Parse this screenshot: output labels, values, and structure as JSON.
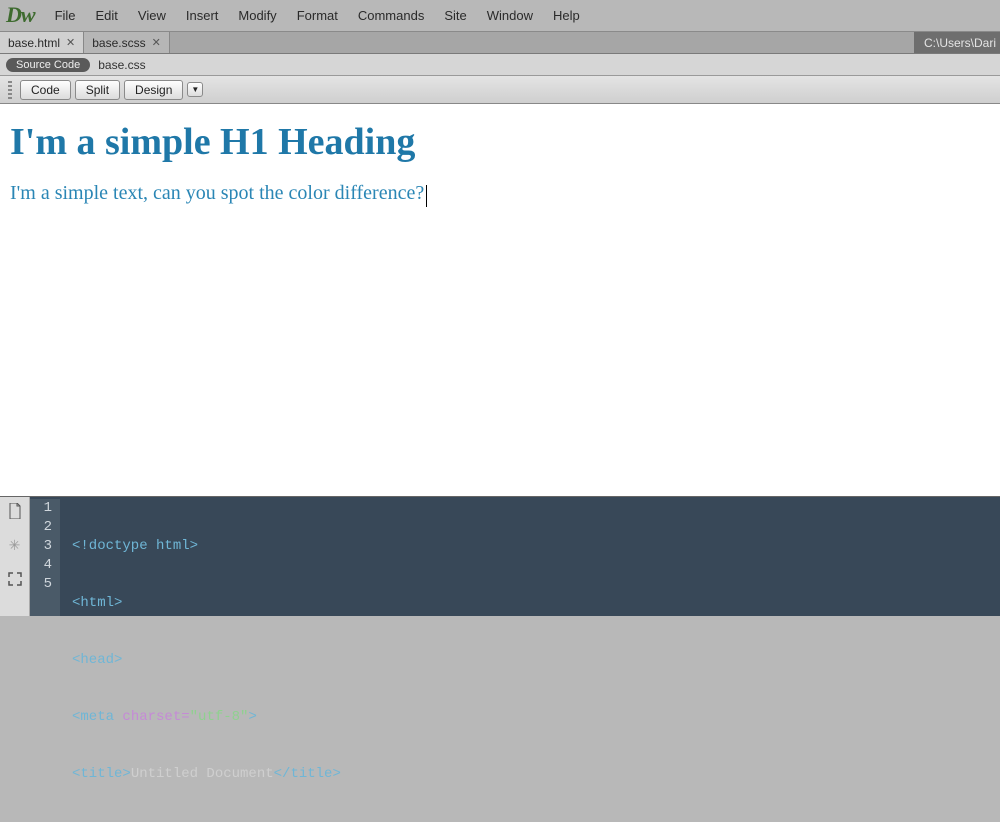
{
  "app": {
    "logo_text": "Dw"
  },
  "menubar": {
    "items": [
      "File",
      "Edit",
      "View",
      "Insert",
      "Modify",
      "Format",
      "Commands",
      "Site",
      "Window",
      "Help"
    ]
  },
  "file_tabs": {
    "active": 0,
    "tabs": [
      {
        "label": "base.html"
      },
      {
        "label": "base.scss"
      }
    ],
    "path": "C:\\Users\\Dari"
  },
  "related": {
    "source_code_label": "Source Code",
    "items": [
      "base.css"
    ]
  },
  "view_toolbar": {
    "code": "Code",
    "split": "Split",
    "design": "Design",
    "dropdown_glyph": "▼"
  },
  "design": {
    "h1_text": "I'm a simple H1 Heading",
    "p_text": "I'm a simple text, can you spot the color difference?"
  },
  "code": {
    "lines": [
      {
        "n": "1",
        "html": "<span class='tok-doctype'>&lt;!doctype html&gt;</span>"
      },
      {
        "n": "2",
        "html": "<span class='tok-tag'>&lt;html&gt;</span>"
      },
      {
        "n": "3",
        "html": "<span class='tok-tag'>&lt;head&gt;</span>"
      },
      {
        "n": "4",
        "html": "<span class='tok-tag'>&lt;meta</span> <span class='tok-attr'>charset=</span><span class='tok-val'>\"utf-8\"</span><span class='tok-tag'>&gt;</span>"
      },
      {
        "n": "5",
        "html": "<span class='tok-tag'>&lt;title&gt;</span><span class='tok-text'>Untitled Document</span><span class='tok-tag'>&lt;/title&gt;</span>"
      }
    ]
  }
}
